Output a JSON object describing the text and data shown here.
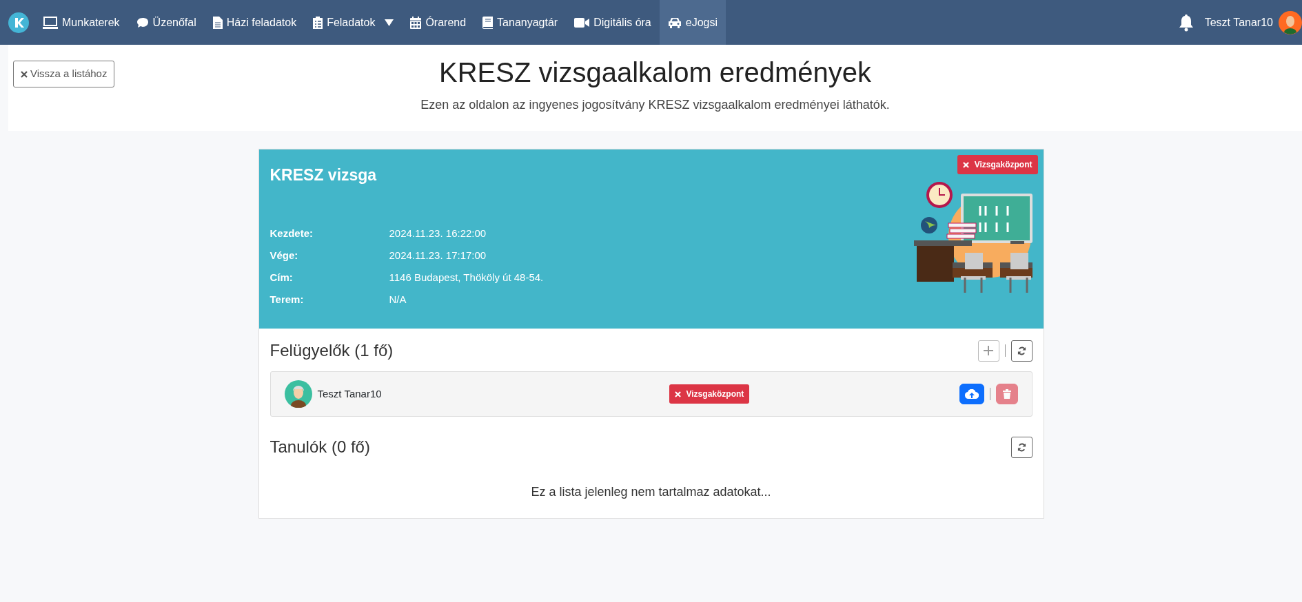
{
  "navbar": {
    "items": [
      {
        "label": "Munkaterek",
        "selected": false,
        "dropdown": false
      },
      {
        "label": "Üzenőfal",
        "selected": false,
        "dropdown": false
      },
      {
        "label": "Házi feladatok",
        "selected": false,
        "dropdown": false
      },
      {
        "label": "Feladatok",
        "selected": false,
        "dropdown": true
      },
      {
        "label": "Órarend",
        "selected": false,
        "dropdown": false
      },
      {
        "label": "Tananyagtár",
        "selected": false,
        "dropdown": false
      },
      {
        "label": "Digitális óra",
        "selected": false,
        "dropdown": false
      },
      {
        "label": "eJogsi",
        "selected": true,
        "dropdown": false
      }
    ],
    "user": "Teszt Tanar10"
  },
  "header": {
    "back_button": "Vissza a listához",
    "title": "KRESZ vizsgaalkalom eredmények",
    "subtitle": "Ezen az oldalon az ingyenes jogosítvány KRESZ vizsgaalkalom eredményei láthatók."
  },
  "exam": {
    "title": "KRESZ vizsga",
    "badge": "Vizsgaközpont",
    "fields": [
      {
        "label": "Kezdete:",
        "value": "2024.11.23. 16:22:00"
      },
      {
        "label": "Vége:",
        "value": "2024.11.23. 17:17:00"
      },
      {
        "label": "Cím:",
        "value": "1146 Budapest, Thököly út 48-54."
      },
      {
        "label": "Terem:",
        "value": "N/A"
      }
    ]
  },
  "supervisors": {
    "title": "Felügyelők (1 fő)",
    "add_disabled": true,
    "rows": [
      {
        "name": "Teszt Tanar10",
        "badge": "Vizsgaközpont",
        "delete_disabled": true
      }
    ]
  },
  "students": {
    "title": "Tanulók (0 fő)",
    "empty_text": "Ez a lista jelenleg nem tartalmaz adatokat..."
  }
}
